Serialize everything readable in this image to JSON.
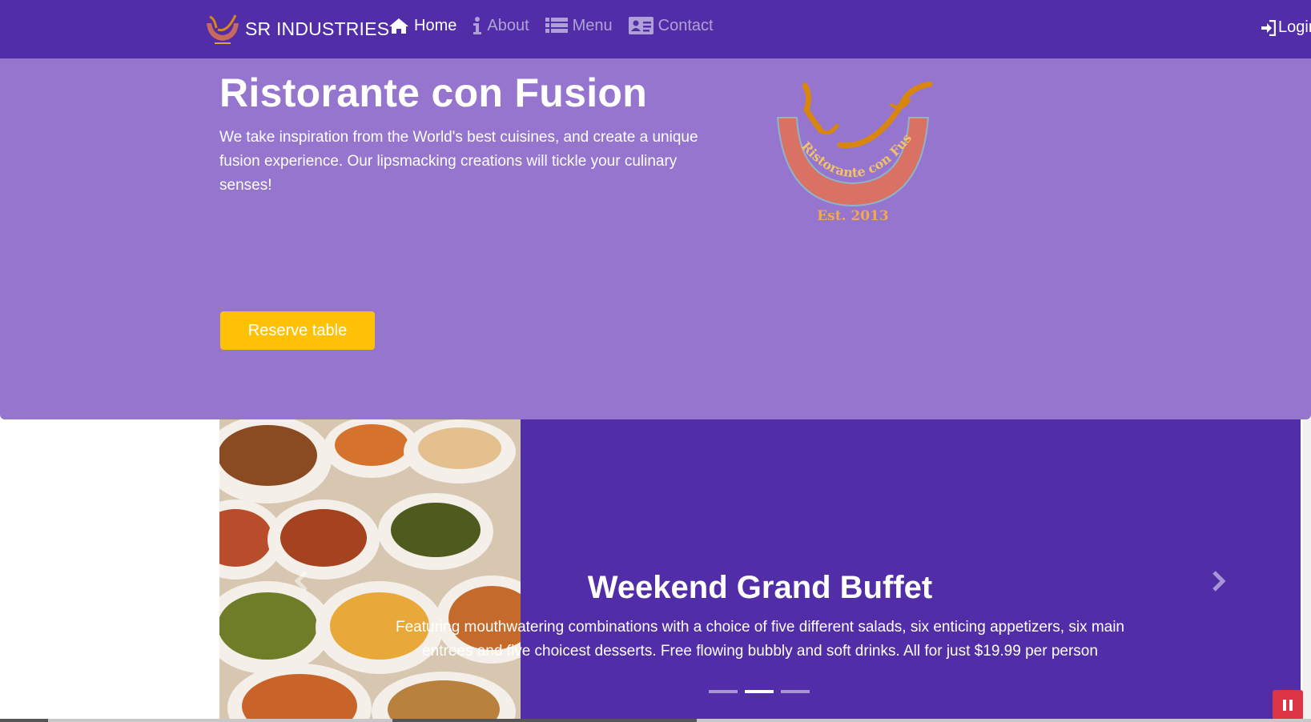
{
  "navbar": {
    "brand": "SR INDUSTRIES",
    "items": [
      {
        "label": "Home",
        "icon": "home-icon",
        "active": true
      },
      {
        "label": "About",
        "icon": "info-icon",
        "active": false
      },
      {
        "label": "Menu",
        "icon": "list-icon",
        "active": false
      },
      {
        "label": "Contact",
        "icon": "address-card-icon",
        "active": false
      }
    ],
    "login_label": "Login"
  },
  "jumbotron": {
    "title": "Ristorante con Fusion",
    "text": "We take inspiration from the World's best cuisines, and create a unique fusion experience. Our lipsmacking creations will tickle your culinary senses!",
    "logo_text": "Ristorante con Fusion",
    "logo_year": "Est. 2013",
    "reserve_label": "Reserve table"
  },
  "carousel": {
    "title": "Weekend Grand Buffet",
    "text": "Featuring mouthwatering combinations with a choice of five different salads, six enticing appetizers, six main entrees and five choicest desserts. Free flowing bubbly and soft drinks. All for just $19.99 per person",
    "active_index": 1,
    "slide_count": 3
  },
  "colors": {
    "primary": "#512DA8",
    "jumbotron": "#9575CD",
    "accent": "#FFC107",
    "danger": "#DC3545"
  }
}
